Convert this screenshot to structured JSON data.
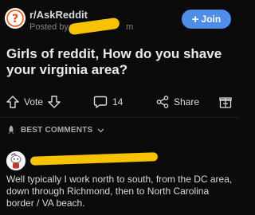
{
  "post": {
    "subreddit": "r/AskReddit",
    "posted_by": "Posted by u/",
    "posted_by_tail": "m",
    "join_label": "Join",
    "title": "Girls of reddit, How do you shave your virginia area?"
  },
  "actions": {
    "vote_label": "Vote",
    "comments_count": "14",
    "share_label": "Share"
  },
  "sort": {
    "label": "BEST COMMENTS"
  },
  "comment": {
    "text": "Well typically I work north to south, from the DC area, down through Richmond, then to North Carolina border / VA beach."
  },
  "colors": {
    "background": "#0b0b0b",
    "join_button": "#4f8de8",
    "redaction": "#f7c300"
  }
}
